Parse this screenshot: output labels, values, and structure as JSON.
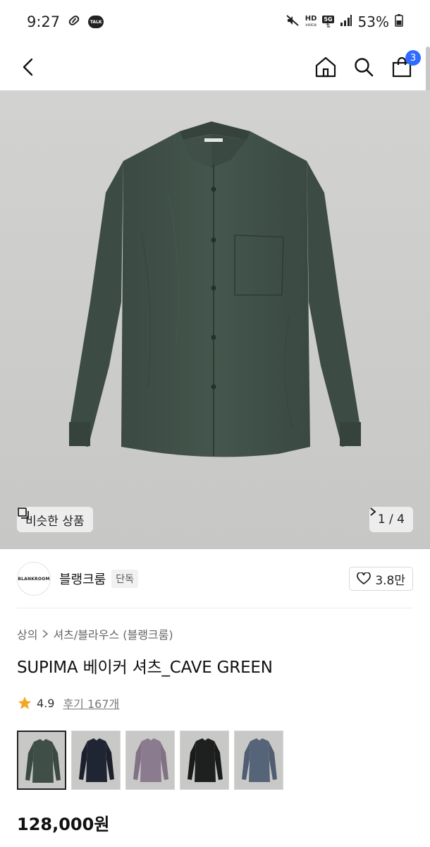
{
  "status_bar": {
    "time": "9:27",
    "talk_label": "TALK",
    "hd_label": "HD",
    "voice_label": "voice",
    "network_label": "5G",
    "battery": "53%"
  },
  "header": {
    "cart_count": "3"
  },
  "hero": {
    "similar_label": "비슷한 상품",
    "pager": "1 / 4",
    "shirt_color": "#3f4f47"
  },
  "brand": {
    "logo_text": "BLANKROOM",
    "name": "블랭크룸",
    "exclusive_tag": "단독",
    "likes": "3.8만"
  },
  "product": {
    "breadcrumb": [
      "상의",
      "셔츠/블라우스 (블랭크룸)"
    ],
    "title": "SUPIMA 베이커 셔츠_CAVE GREEN",
    "rating": "4.9",
    "reviews": "후기 167개",
    "price": "128,000원",
    "colors": [
      {
        "name": "cave green",
        "hex": "#3f4f47"
      },
      {
        "name": "navy",
        "hex": "#1f2533"
      },
      {
        "name": "lavender",
        "hex": "#8a7b8e"
      },
      {
        "name": "black",
        "hex": "#1e1f1f"
      },
      {
        "name": "blue grey",
        "hex": "#56647a"
      }
    ]
  },
  "colors": {
    "accent": "#2f6bff",
    "star": "#f5a623"
  }
}
